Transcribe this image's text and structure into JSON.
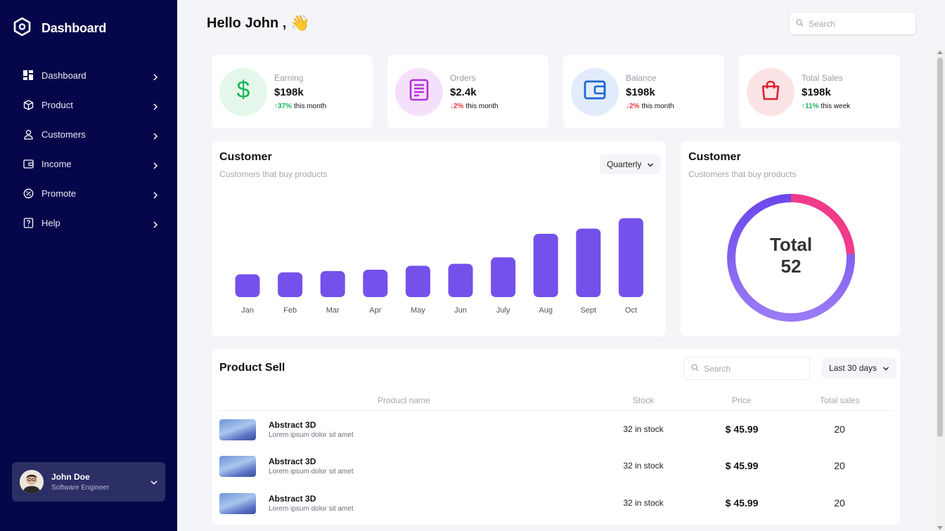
{
  "sidebar": {
    "brand": "Dashboard",
    "items": [
      {
        "label": "Dashboard",
        "icon": "dashboard-grid-icon"
      },
      {
        "label": "Product",
        "icon": "box-icon"
      },
      {
        "label": "Customers",
        "icon": "user-icon"
      },
      {
        "label": "Income",
        "icon": "wallet-icon"
      },
      {
        "label": "Promote",
        "icon": "discount-icon"
      },
      {
        "label": "Help",
        "icon": "help-icon"
      }
    ],
    "profile": {
      "name": "John Doe",
      "role": "Software Engineer"
    }
  },
  "header": {
    "greeting": "Hello John ,",
    "wave": "👋",
    "search_placeholder": "Search"
  },
  "stats": [
    {
      "label": "Earning",
      "value": "$198k",
      "change": "37%",
      "direction": "up",
      "period": "this month",
      "color": "#1bb55a",
      "bg": "#e4f7ea",
      "icon": "dollar-icon"
    },
    {
      "label": "Orders",
      "value": "$2.4k",
      "change": "2%",
      "direction": "down",
      "period": "this month",
      "color": "#b42fd9",
      "bg": "#f5e0fb",
      "icon": "document-icon"
    },
    {
      "label": "Balance",
      "value": "$198k",
      "change": "2%",
      "direction": "down",
      "period": "this month",
      "color": "#1e66d0",
      "bg": "#e3ecfa",
      "icon": "wallet-icon"
    },
    {
      "label": "Total Sales",
      "value": "$198k",
      "change": "11%",
      "direction": "up",
      "period": "this week",
      "color": "#e02034",
      "bg": "#fbe3e6",
      "icon": "shopping-bag-icon"
    }
  ],
  "customer_bar": {
    "title": "Customer",
    "subtitle": "Customers that buy products",
    "dropdown": "Quarterly"
  },
  "customer_donut": {
    "title": "Customer",
    "subtitle": "Customers that buy products",
    "center_label": "Total",
    "center_value": "52"
  },
  "chart_data": [
    {
      "type": "bar",
      "categories": [
        "Jan",
        "Feb",
        "Mar",
        "Apr",
        "May",
        "Jun",
        "July",
        "Aug",
        "Sept",
        "Oct"
      ],
      "values": [
        35,
        38,
        40,
        42,
        48,
        51,
        61,
        97,
        105,
        121
      ],
      "color": "#7451eb"
    },
    {
      "type": "pie",
      "total": 52,
      "slices": [
        {
          "value": 76,
          "color": "#7a57ee"
        },
        {
          "value": 24,
          "color": "#f03a8a"
        }
      ]
    }
  ],
  "product_sell": {
    "title": "Product Sell",
    "search_placeholder": "Search",
    "range": "Last 30 days",
    "columns": [
      "Product name",
      "Stock",
      "Price",
      "Total sales"
    ],
    "rows": [
      {
        "name": "Abstract 3D",
        "desc": "Lorem ipsum dolor sit amet",
        "stock": "32 in stock",
        "price": "$ 45.99",
        "sales": "20"
      },
      {
        "name": "Abstract 3D",
        "desc": "Lorem ipsum dolor sit amet",
        "stock": "32 in stock",
        "price": "$ 45.99",
        "sales": "20"
      },
      {
        "name": "Abstract 3D",
        "desc": "Lorem ipsum dolor sit amet",
        "stock": "32 in stock",
        "price": "$ 45.99",
        "sales": "20"
      }
    ]
  }
}
